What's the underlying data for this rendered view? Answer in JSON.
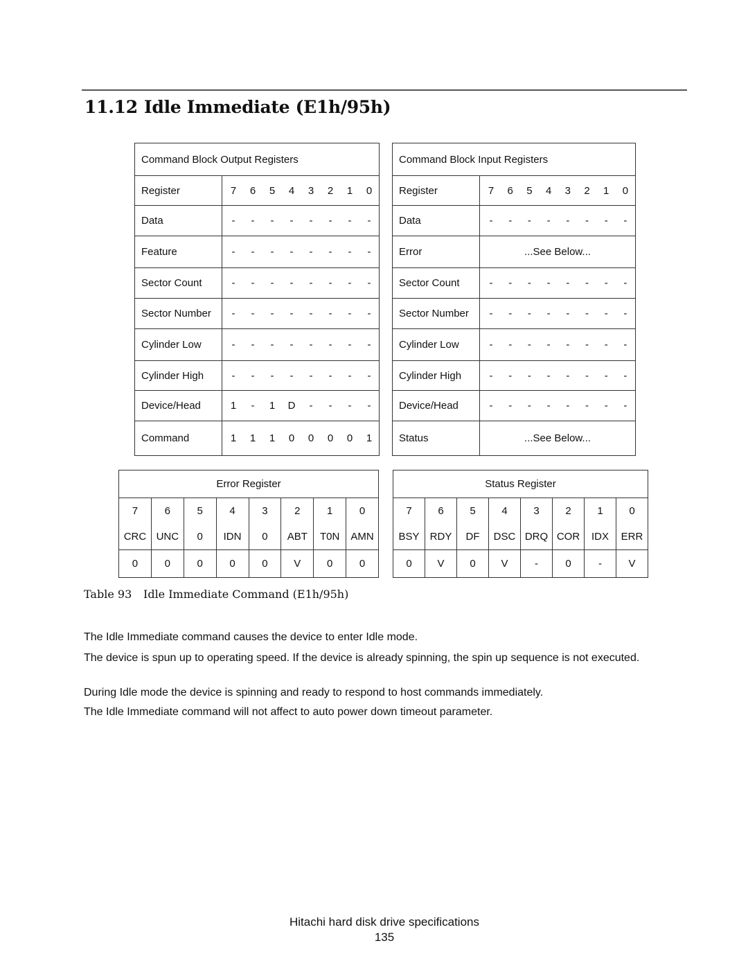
{
  "section": {
    "number": "11.12",
    "title": "Idle Immediate (E1h/95h)"
  },
  "output_registers": {
    "title": "Command Block Output Registers",
    "header": {
      "label": "Register",
      "bits": [
        "7",
        "6",
        "5",
        "4",
        "3",
        "2",
        "1",
        "0"
      ]
    },
    "rows": [
      {
        "label": "Data",
        "bits": [
          "-",
          "-",
          "-",
          "-",
          "-",
          "-",
          "-",
          "-"
        ]
      },
      {
        "label": "Feature",
        "bits": [
          "-",
          "-",
          "-",
          "-",
          "-",
          "-",
          "-",
          "-"
        ]
      },
      {
        "label": "Sector Count",
        "bits": [
          "-",
          "-",
          "-",
          "-",
          "-",
          "-",
          "-",
          "-"
        ]
      },
      {
        "label": "Sector Number",
        "bits": [
          "-",
          "-",
          "-",
          "-",
          "-",
          "-",
          "-",
          "-"
        ]
      },
      {
        "label": "Cylinder Low",
        "bits": [
          "-",
          "-",
          "-",
          "-",
          "-",
          "-",
          "-",
          "-"
        ]
      },
      {
        "label": "Cylinder High",
        "bits": [
          "-",
          "-",
          "-",
          "-",
          "-",
          "-",
          "-",
          "-"
        ]
      },
      {
        "label": "Device/Head",
        "bits": [
          "1",
          "-",
          "1",
          "D",
          "-",
          "-",
          "-",
          "-"
        ]
      },
      {
        "label": "Command",
        "bits": [
          "1",
          "1",
          "1",
          "0",
          "0",
          "0",
          "0",
          "1"
        ]
      }
    ]
  },
  "input_registers": {
    "title": "Command Block Input Registers",
    "header": {
      "label": "Register",
      "bits": [
        "7",
        "6",
        "5",
        "4",
        "3",
        "2",
        "1",
        "0"
      ]
    },
    "rows": [
      {
        "label": "Data",
        "bits": [
          "-",
          "-",
          "-",
          "-",
          "-",
          "-",
          "-",
          "-"
        ]
      },
      {
        "label": "Error",
        "note": "...See Below..."
      },
      {
        "label": "Sector Count",
        "bits": [
          "-",
          "-",
          "-",
          "-",
          "-",
          "-",
          "-",
          "-"
        ]
      },
      {
        "label": "Sector Number",
        "bits": [
          "-",
          "-",
          "-",
          "-",
          "-",
          "-",
          "-",
          "-"
        ]
      },
      {
        "label": "Cylinder Low",
        "bits": [
          "-",
          "-",
          "-",
          "-",
          "-",
          "-",
          "-",
          "-"
        ]
      },
      {
        "label": "Cylinder High",
        "bits": [
          "-",
          "-",
          "-",
          "-",
          "-",
          "-",
          "-",
          "-"
        ]
      },
      {
        "label": "Device/Head",
        "bits": [
          "-",
          "-",
          "-",
          "-",
          "-",
          "-",
          "-",
          "-"
        ]
      },
      {
        "label": "Status",
        "note": "...See Below..."
      }
    ]
  },
  "error_register": {
    "title": "Error Register",
    "bit_numbers": [
      "7",
      "6",
      "5",
      "4",
      "3",
      "2",
      "1",
      "0"
    ],
    "bit_names": [
      "CRC",
      "UNC",
      "0",
      "IDN",
      "0",
      "ABT",
      "T0N",
      "AMN"
    ],
    "values": [
      "0",
      "0",
      "0",
      "0",
      "0",
      "V",
      "0",
      "0"
    ]
  },
  "status_register": {
    "title": "Status Register",
    "bit_numbers": [
      "7",
      "6",
      "5",
      "4",
      "3",
      "2",
      "1",
      "0"
    ],
    "bit_names": [
      "BSY",
      "RDY",
      "DF",
      "DSC",
      "DRQ",
      "COR",
      "IDX",
      "ERR"
    ],
    "values": [
      "0",
      "V",
      "0",
      "V",
      "-",
      "0",
      "-",
      "V"
    ]
  },
  "caption": {
    "number": "Table 93",
    "text": "Idle Immediate Command (E1h/95h)"
  },
  "paragraphs": [
    "The Idle Immediate command causes the device to enter Idle mode.",
    "The device is spun up to operating speed. If the device is already spinning, the spin up sequence is not executed.",
    "During Idle mode the device is spinning and ready to respond to host commands immediately.",
    "The Idle Immediate command will not affect to auto power down timeout parameter."
  ],
  "footer": {
    "title": "Hitachi hard disk drive specifications",
    "page": "135"
  }
}
